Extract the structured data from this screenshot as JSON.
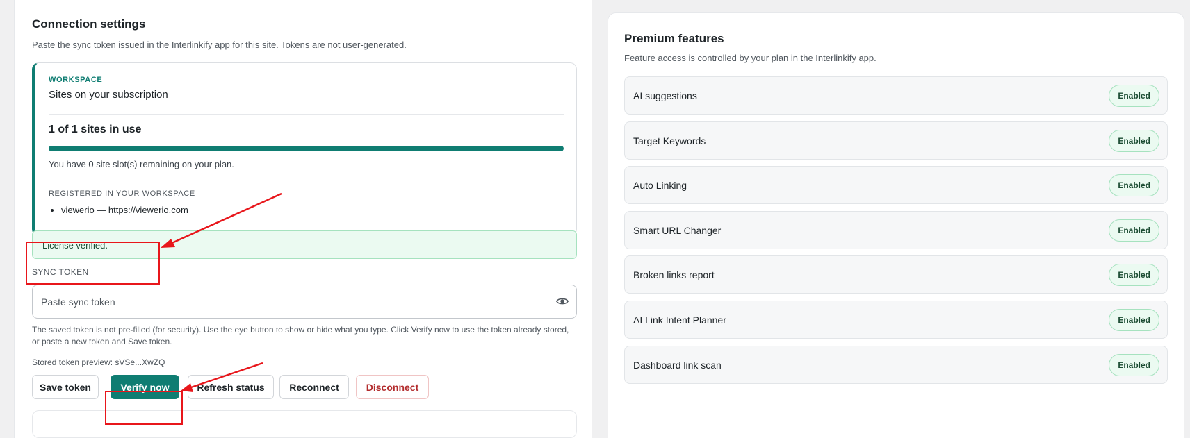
{
  "connection": {
    "title": "Connection settings",
    "description": "Paste the sync token issued in the Interlinkify app for this site. Tokens are not user-generated.",
    "workspace": {
      "kicker": "WORKSPACE",
      "title": "Sites on your subscription",
      "usage_text": "1 of 1 sites in use",
      "usage_fraction": 1.0,
      "remaining_text": "You have 0 site slot(s) remaining on your plan.",
      "registered_label": "REGISTERED IN YOUR WORKSPACE",
      "sites": [
        "viewerio — https://viewerio.com"
      ]
    },
    "notice": "License verified.",
    "sync_label": "SYNC TOKEN",
    "input_placeholder": "Paste sync token",
    "help_text": "The saved token is not pre-filled (for security). Use the eye button to show or hide what you type. Click Verify now to use the token already stored, or paste a new token and Save token.",
    "preview": "Stored token preview: sVSe...XwZQ",
    "buttons": {
      "save": "Save token",
      "verify": "Verify now",
      "refresh": "Refresh status",
      "reconnect": "Reconnect",
      "disconnect": "Disconnect"
    }
  },
  "premium": {
    "title": "Premium features",
    "description": "Feature access is controlled by your plan in the Interlinkify app.",
    "features": [
      {
        "label": "AI suggestions",
        "status": "Enabled"
      },
      {
        "label": "Target Keywords",
        "status": "Enabled"
      },
      {
        "label": "Auto Linking",
        "status": "Enabled"
      },
      {
        "label": "Smart URL Changer",
        "status": "Enabled"
      },
      {
        "label": "Broken links report",
        "status": "Enabled"
      },
      {
        "label": "AI Link Intent Planner",
        "status": "Enabled"
      },
      {
        "label": "Dashboard link scan",
        "status": "Enabled"
      }
    ]
  },
  "colors": {
    "accent": "#0f7d72",
    "success_bg": "#ebfaf1",
    "danger": "#b32d2e",
    "annotation": "#e8161b"
  }
}
